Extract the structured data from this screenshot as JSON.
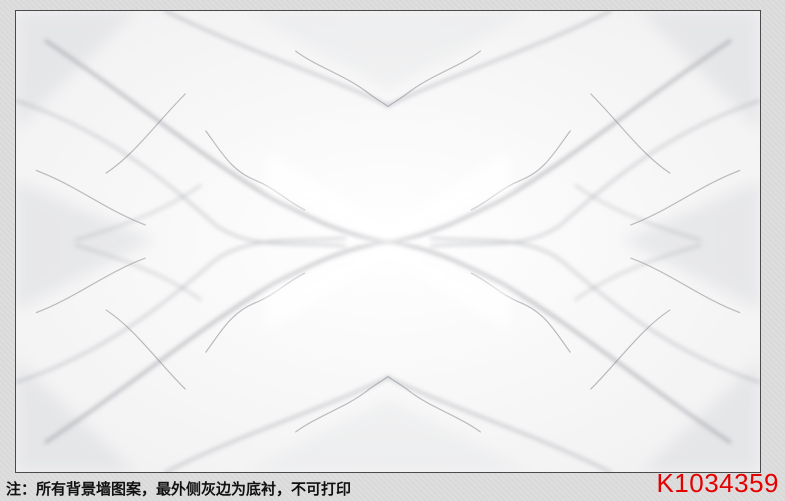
{
  "caption": "注：所有背景墙图案，最外侧灰边为底衬，不可打印",
  "product_code": "K1034359",
  "colors": {
    "backing": "#dcdcdc",
    "marble_base": "#fafafa",
    "vein": "#9a9aa0",
    "code_red": "#e50000"
  }
}
